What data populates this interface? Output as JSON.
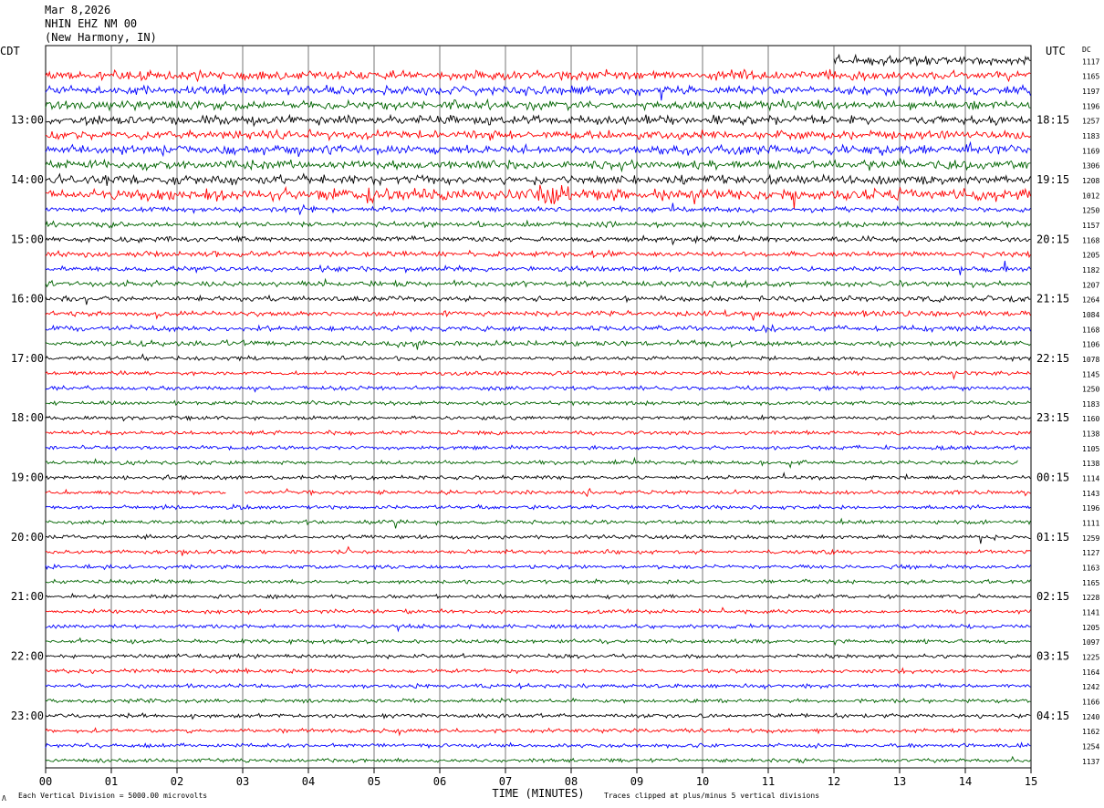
{
  "header": {
    "date": "Mar 8,2026",
    "station": "NHIN EHZ NM 00",
    "location": "(New Harmony, IN)"
  },
  "chart_data": {
    "type": "line",
    "title": "",
    "left_axis_label": "CDT",
    "right_axis_label": "UTC",
    "dc_label": "DC",
    "xlabel": "TIME (MINUTES)",
    "x_ticks": [
      "00",
      "01",
      "02",
      "03",
      "04",
      "05",
      "06",
      "07",
      "08",
      "09",
      "10",
      "11",
      "12",
      "13",
      "14",
      "15"
    ],
    "xlim": [
      0,
      15
    ],
    "left_hour_labels": [
      "13:00",
      "14:00",
      "15:00",
      "16:00",
      "17:00",
      "18:00",
      "19:00",
      "20:00",
      "21:00",
      "22:00",
      "23:00"
    ],
    "right_hour_labels": [
      "18:15",
      "19:15",
      "20:15",
      "21:15",
      "22:15",
      "23:15",
      "00:15",
      "01:15",
      "02:15",
      "03:15",
      "04:15"
    ],
    "trace_colors": [
      "#000000",
      "#ff0000",
      "#0000ff",
      "#006400"
    ],
    "dc_values": [
      "1117",
      "1165",
      "1197",
      "1196",
      "1257",
      "1183",
      "1169",
      "1306",
      "1208",
      "1012",
      "1250",
      "1157",
      "1168",
      "1205",
      "1182",
      "1207",
      "1264",
      "1084",
      "1168",
      "1106",
      "1078",
      "1145",
      "1250",
      "1183",
      "1160",
      "1138",
      "1105",
      "1138",
      "1114",
      "1143",
      "1196",
      "1111",
      "1259",
      "1127",
      "1163",
      "1165",
      "1228",
      "1141",
      "1205",
      "1097",
      "1225",
      "1164",
      "1242",
      "1166",
      "1240",
      "1162",
      "1254",
      "1137"
    ],
    "footer_left": "Each Vertical Division = 5000.00 microvolts",
    "footer_right": "Traces clipped at plus/minus 5 vertical divisions",
    "footer_mark": "Λ"
  }
}
